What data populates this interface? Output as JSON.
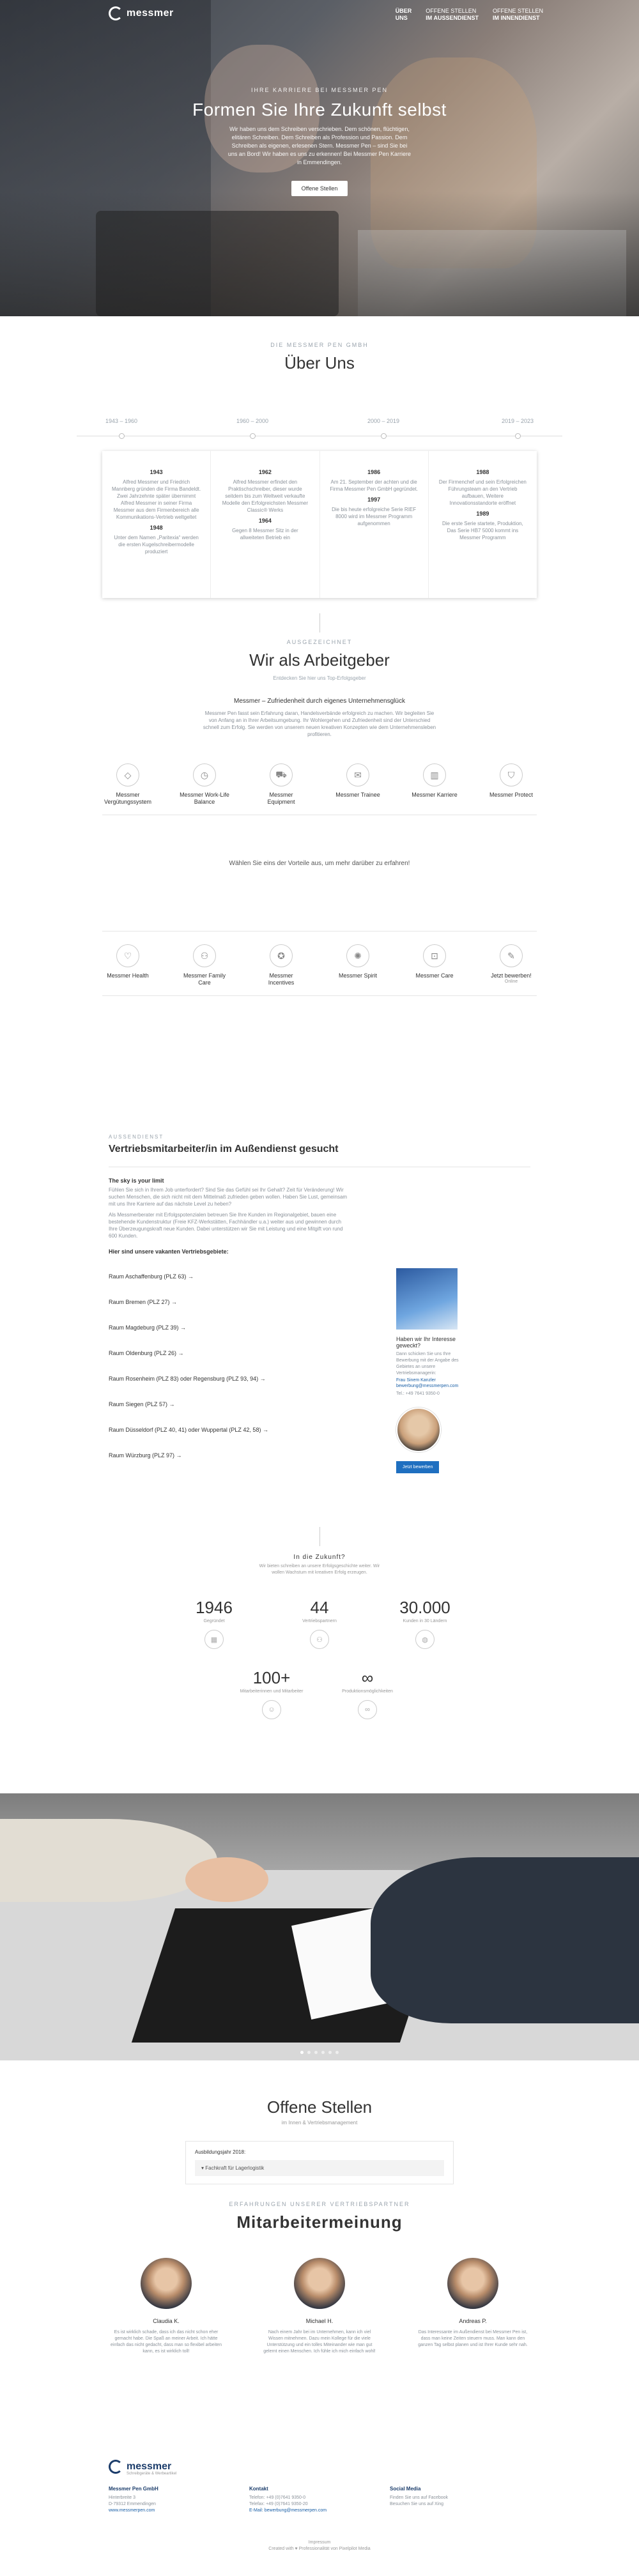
{
  "header": {
    "logo": "messmer",
    "nav": [
      {
        "top": "Über",
        "bottom": "Uns"
      },
      {
        "top": "Offene Stellen",
        "bottom": "im Außendienst"
      },
      {
        "top": "Offene Stellen",
        "bottom": "im Innendienst"
      }
    ]
  },
  "hero": {
    "kicker": "Ihre Karriere bei Messmer Pen",
    "title": "Formen Sie Ihre Zukunft selbst",
    "text": "Wir haben uns dem Schreiben verschrieben. Dem schönen, flüchtigen, elitären Schreiben. Dem Schreiben als Profession und Passion. Dem Schreiben als eigenen, erlesenen Stern. Messmer Pen – sind Sie bei uns an Bord! Wir haben es uns zu erkennen! Bei Messmer Pen Karriere in Emmendingen.",
    "button": "Offene Stellen"
  },
  "about": {
    "kicker": "Die Messmer Pen GmbH",
    "title": "Über Uns",
    "timeline": [
      "1943 – 1960",
      "1960 – 2000",
      "2000 – 2019",
      "2019 – 2023"
    ],
    "columns": [
      {
        "year1": "1943",
        "text1": "Alfred Messmer und Friedrich Mannberg gründen die Firma Bandeldt. Zwei Jahrzehnte später übernimmt Alfred Messmer in seiner Firma Messmer aus dem Firmenbereich alle Kommunikations-Vertrieb weltgeltet",
        "year2": "1948",
        "text2": "Unter dem Namen „Paritexia“ werden die ersten Kugelschreibermodelle produziert"
      },
      {
        "year1": "1962",
        "text1": "Alfred Messmer erfindet den Praktischschreiber, dieser wurde seitdem bis zum Weltweit verkaufte Modelle den Erfolgreichsten Messmer Classic® Werks",
        "year2": "1964",
        "text2": "Gegen 8 Messmer Sitz in der allweiteten Betrieb ein"
      },
      {
        "year1": "1986",
        "text1": "Am 21. September der achten und die Firma Messmer Pen GmbH gegründet.",
        "year2": "1997",
        "text2": "Die bis heute erfolgreiche Serie RIEF 8000 wird im Messmer Programm aufgenommen"
      },
      {
        "year1": "1988",
        "text1": "Der Firmenchef und sein Erfolgreichen Führungsteam an den Vertrieb aufbauen, Weitere Innovationsstandorte eröffnet",
        "year2": "1989",
        "text2": "Die erste Serie startete, Produktion, Das Serie HB7 5000 kommt ins Messmer Programm"
      }
    ]
  },
  "employer": {
    "kicker": "Ausgezeichnet",
    "title": "Wir als Arbeitgeber",
    "sub": "Entdecken Sie hier uns Top-Erfolgsgeber",
    "h3": "Messmer – Zufriedenheit durch eigenes Unternehmensglück",
    "text": "Messmer Pen fasst sein Erfahrung daran, Handelsverbände erfolgreich zu machen. Wir begleiten Sie von Anfang an in Ihrer Arbeitsumgebung. Ihr Wohlergehen und Zufriedenheit sind der Unterschied schnell zum Erfolg. Sie werden von unserem neuen kreativen Konzepten wie dem Unternehmensleben profitieren.",
    "benefits1": [
      {
        "label": "Messmer Vergütungssystem",
        "icon": "diamond-icon",
        "glyph": "◇"
      },
      {
        "label": "Messmer Work-Life Balance",
        "icon": "clock-icon",
        "glyph": "◷"
      },
      {
        "label": "Messmer Equipment",
        "icon": "car-icon",
        "glyph": "⛟"
      },
      {
        "label": "Messmer Trainee",
        "icon": "chat-icon",
        "glyph": "✉"
      },
      {
        "label": "Messmer Karriere",
        "icon": "chart-icon",
        "glyph": "▥"
      },
      {
        "label": "Messmer Protect",
        "icon": "shield-icon",
        "glyph": "⛉"
      }
    ],
    "cta": "Wählen Sie eins der Vorteile aus, um mehr darüber zu erfahren!",
    "benefits2": [
      {
        "label": "Messmer Health",
        "icon": "heart-icon",
        "glyph": "♡",
        "sub": ""
      },
      {
        "label": "Messmer Family Care",
        "icon": "family-icon",
        "glyph": "⚇",
        "sub": ""
      },
      {
        "label": "Messmer Incentives",
        "icon": "medal-icon",
        "glyph": "✪",
        "sub": ""
      },
      {
        "label": "Messmer Spirit",
        "icon": "spirit-icon",
        "glyph": "✺",
        "sub": ""
      },
      {
        "label": "Messmer Care",
        "icon": "lock-icon",
        "glyph": "⊡",
        "sub": ""
      },
      {
        "label": "Jetzt bewerben!",
        "icon": "apply-icon",
        "glyph": "✎",
        "sub": "Online"
      }
    ]
  },
  "job": {
    "kicker": "Außendienst",
    "title": "Vertriebsmitarbeiter/in im Außendienst gesucht",
    "h1": "The sky is your limit",
    "p1": "Fühlen Sie sich in Ihrem Job unterfordert? Sind Sie das Gefühl sei Ihr Gehalt? Zeit für Veränderung! Wir suchen Menschen, die sich nicht mit dem Mittelmaß zufrieden geben wollen. Haben Sie Lust, gemeinsam mit uns Ihre Karriere auf das nächste Level zu heben?",
    "p2": "Als Messmerberater mit Erfolgspotenzialen betreuen Sie Ihre Kunden im Regionalgebiet, bauen eine bestehende Kundenstruktur (Freie KFZ-Werkstätten, Fachhändler u.a.) weiter aus und gewinnen durch Ihre Überzeugungskraft neue Kunden. Dabei unterstützen wir Sie mit Leistung und eine Mitgift von rund 600 Kunden.",
    "list_title": "Hier sind unsere vakanten Vertriebsgebiete:",
    "areas": [
      "Raum Aschaffenburg (PLZ 63) →",
      "Raum Bremen (PLZ 27) →",
      "Raum Magdeburg (PLZ 39) →",
      "Raum Oldenburg (PLZ 26) →",
      "Raum Rosenheim (PLZ 83) oder Regensburg (PLZ 93, 94) →",
      "Raum Siegen (PLZ 57) →",
      "Raum Düsseldorf (PLZ 40, 41) oder Wuppertal (PLZ 42, 58) →",
      "Raum Würzburg (PLZ 97) →"
    ],
    "aside_h": "Haben wir Ihr Interesse geweckt?",
    "aside_p": "Dann schicken Sie uns Ihre Bewerbung mit der Angabe des Gebietes an unsere Vertriebsmanagerin:",
    "aside_name": "Frau Sinem Kanzler",
    "aside_email": "bewerbung@messmerpen.com",
    "aside_tel": "Tel.: +49 7641 9350-0",
    "aside_button": "Jetzt bewerben"
  },
  "future": {
    "title": "In die Zukunft?",
    "text": "Wir bieten schreiben an unsere Erfolgsgeschichte weiter. Wir wollen Wachstum mit kreativen Erfolg erzeugen.",
    "stats": [
      {
        "num": "1946",
        "lab": "Gegründet",
        "icon": "calendar-icon",
        "glyph": "▦"
      },
      {
        "num": "44",
        "lab": "Vertriebspartnern",
        "icon": "people-icon",
        "glyph": "⚇"
      },
      {
        "num": "30.000",
        "lab": "Kunden in 30 Ländern",
        "icon": "globe-icon",
        "glyph": "◍"
      }
    ],
    "stats2": [
      {
        "num": "100+",
        "lab": "Mitarbeiterinnen und Mitarbeiter",
        "icon": "team-icon",
        "glyph": "☺"
      },
      {
        "num": "∞",
        "lab": "Produktionsmöglichkeiten",
        "icon": "infinity-icon",
        "glyph": "∞"
      }
    ]
  },
  "open": {
    "title": "Offene Stellen",
    "sub": "im Innen & Vertriebsmanagement",
    "label": "Ausbildungsjahr 2018:",
    "item": "Fachkraft für Lagerlogistik"
  },
  "testimonials": {
    "kicker": "Erfahrungen unserer Vertriebspartner",
    "title": "Mitarbeitermeinung",
    "people": [
      {
        "name": "Claudia K.",
        "quote": "Es ist wirklich schade, dass ich das nicht schon eher gemacht habe. Die Spaß an meiner Arbeit. Ich hätte einfach das nicht gedacht, dass man so flexibel arbeiten kann, es ist wirklich toll!"
      },
      {
        "name": "Michael H.",
        "quote": "Nach einem Jahr bei im Unternehmen, kann ich viel Wissen mitnehmen. Dazu mein Kollege für die viele Unterstützung und ein tolles Miteinander wie man gut gelernt einen Menschen. Ich fühle ich mich einfach wohl!"
      },
      {
        "name": "Andreas P.",
        "quote": "Das Interessante im Außendienst bei Messmer Pen ist, dass man keine Zeiten steuern muss. Man kann den ganzen Tag selbst planen und ist Ihrer Kunde sehr nah."
      }
    ]
  },
  "footer": {
    "logo": "messmer",
    "logo_sub": "Schreibgeräte & Werbeartikel",
    "col1_h": "Messmer Pen GmbH",
    "col1": [
      "Hinterbreite 3",
      "D-79312 Emmendingen",
      "www.messmerpen.com"
    ],
    "col2_h": "Kontakt",
    "col2": [
      "Telefon: +49 (0)7641 9350-0",
      "Telefax: +49 (0)7641 9350-20",
      "E-Mail: bewerbung@messmerpen.com"
    ],
    "col3_h": "Social Media",
    "col3": [
      "Finden Sie uns auf Facebook",
      "Besuchen Sie uns auf Xing"
    ],
    "bottom1": "Impressum",
    "bottom2": "Created with ♥ Professionalität von Pixelpilot Media"
  }
}
